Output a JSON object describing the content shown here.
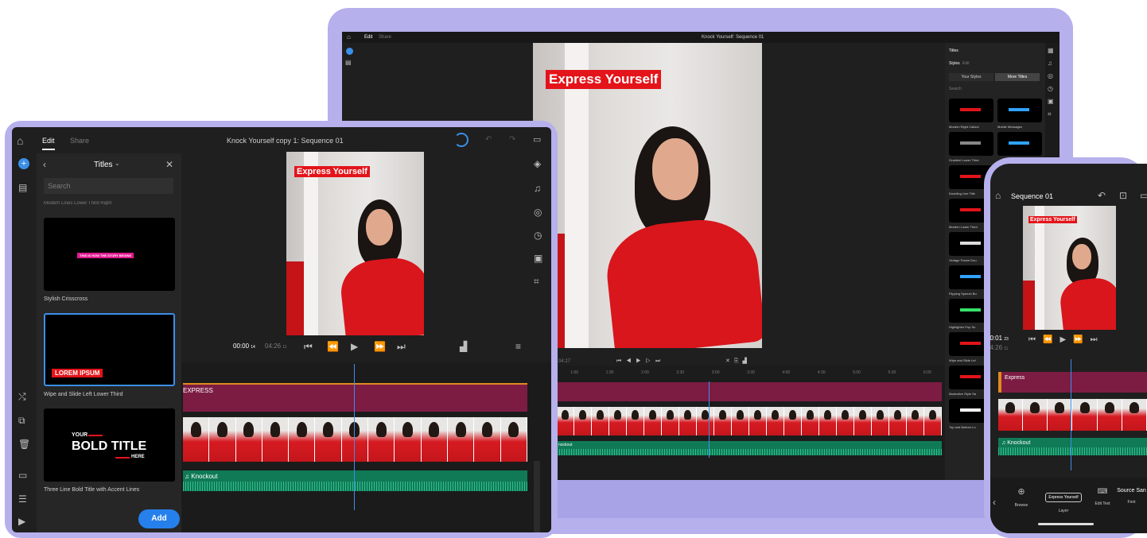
{
  "laptop": {
    "tabs": [
      "Edit",
      "Share"
    ],
    "window_title": "Knock Yourself: Sequence 01",
    "overlay_title": "Express Yourself",
    "panel_title": "Titles",
    "panel_tabs": [
      "Styles",
      "Edit"
    ],
    "panel_buttons": [
      "Your Styles",
      "More Titles"
    ],
    "search_placeholder": "Search",
    "title_items": [
      "Modern Right Callout",
      "Mobile Messages",
      "Gradient Lower Third",
      "",
      "Doubling Line Title",
      "",
      "Modern Lower Third",
      "",
      "Vintage Frame Dou",
      "",
      "Flipping Speech Bu",
      "",
      "Highlighter Pop Su",
      "",
      "Wipe and Slide Lef",
      "",
      "Illustrative Style Sa",
      "",
      "Top and Bottom Lo",
      ""
    ],
    "time_current": "04:27",
    "ruler_ticks": [
      "1:00",
      "1:30",
      "2:00",
      "2:30",
      "3:00",
      "3:30",
      "4:00",
      "4:30",
      "5:00",
      "5:30",
      "6:00"
    ],
    "audio_label": "nockout"
  },
  "tablet": {
    "tabs": [
      "Edit",
      "Share"
    ],
    "window_title": "Knock Yourself copy 1: Sequence 01",
    "panel_title": "Titles",
    "search_placeholder": "Search",
    "partial_item": "Modern Lines Lower Third Right",
    "items": [
      {
        "label": "Stylish Crisscross",
        "preview_text": "THIS IS HOW THE STORY BEGINS"
      },
      {
        "label": "Wipe and Slide Left Lower Third",
        "preview_text": "LOREM IPSUM"
      },
      {
        "label": "Three Line Bold Title with Accent Lines",
        "preview_top": "YOUR",
        "preview_main": "BOLD TITLE",
        "preview_bottom": "HERE"
      }
    ],
    "add_button": "Add",
    "overlay_title": "Express Yourself",
    "time_current": "00:00",
    "time_current_frames": "14",
    "time_total": "04:26",
    "time_total_frames": "11",
    "title_track_label": "EXPRESS",
    "audio_label": "Knockout"
  },
  "phone": {
    "title": "Sequence 01",
    "overlay_title": "Express Yourself",
    "time_current": "00:01",
    "time_current_frames": "23",
    "time_total": "04:26",
    "time_total_frames": "11",
    "title_track_label": "Express",
    "audio_label": "Knockout",
    "bottom_tools": [
      {
        "icon": "plus-circle",
        "label": "Browse"
      },
      {
        "icon": "layer",
        "label": "Layer",
        "chip": "Express Yourself"
      },
      {
        "icon": "keyboard",
        "label": "Edit Text"
      },
      {
        "icon": "font",
        "label": "Font",
        "chip": "Source San"
      }
    ]
  },
  "colors": {
    "device_frame": "#b6b0ec",
    "app_bg": "#1f1f1f",
    "title_clip": "#7c1c43",
    "audio_clip": "#107a57",
    "accent_blue": "#3b8fe8",
    "title_red": "#e3141a"
  }
}
